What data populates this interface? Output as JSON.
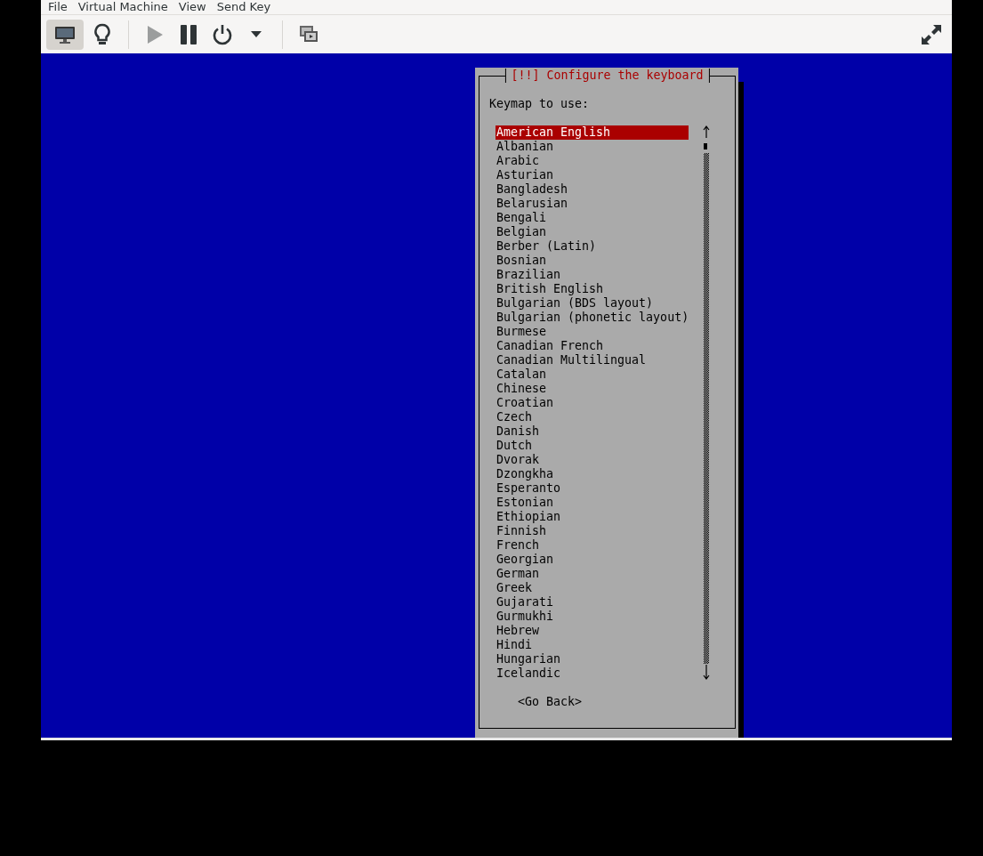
{
  "menu": [
    "File",
    "Virtual Machine",
    "View",
    "Send Key"
  ],
  "toolbar": {
    "groups": [
      [
        {
          "kind": "monitor",
          "selected": true,
          "disabled": false
        },
        {
          "kind": "bulb",
          "selected": false,
          "disabled": false
        }
      ],
      [
        {
          "kind": "play",
          "selected": false,
          "disabled": true
        },
        {
          "kind": "pause",
          "selected": false,
          "disabled": false
        },
        {
          "kind": "power",
          "selected": false,
          "disabled": false
        },
        {
          "kind": "caret",
          "selected": false,
          "disabled": false
        }
      ],
      [
        {
          "kind": "screens",
          "selected": false,
          "disabled": false
        }
      ]
    ],
    "right": [
      {
        "kind": "fullscreen",
        "selected": false,
        "disabled": false
      }
    ]
  },
  "dialog": {
    "title": "[!!] Configure the keyboard",
    "prompt": "Keymap to use:",
    "items": [
      {
        "label": "American English",
        "selected": true
      },
      {
        "label": "Albanian",
        "selected": false
      },
      {
        "label": "Arabic",
        "selected": false
      },
      {
        "label": "Asturian",
        "selected": false
      },
      {
        "label": "Bangladesh",
        "selected": false
      },
      {
        "label": "Belarusian",
        "selected": false
      },
      {
        "label": "Bengali",
        "selected": false
      },
      {
        "label": "Belgian",
        "selected": false
      },
      {
        "label": "Berber (Latin)",
        "selected": false
      },
      {
        "label": "Bosnian",
        "selected": false
      },
      {
        "label": "Brazilian",
        "selected": false
      },
      {
        "label": "British English",
        "selected": false
      },
      {
        "label": "Bulgarian (BDS layout)",
        "selected": false
      },
      {
        "label": "Bulgarian (phonetic layout)",
        "selected": false
      },
      {
        "label": "Burmese",
        "selected": false
      },
      {
        "label": "Canadian French",
        "selected": false
      },
      {
        "label": "Canadian Multilingual",
        "selected": false
      },
      {
        "label": "Catalan",
        "selected": false
      },
      {
        "label": "Chinese",
        "selected": false
      },
      {
        "label": "Croatian",
        "selected": false
      },
      {
        "label": "Czech",
        "selected": false
      },
      {
        "label": "Danish",
        "selected": false
      },
      {
        "label": "Dutch",
        "selected": false
      },
      {
        "label": "Dvorak",
        "selected": false
      },
      {
        "label": "Dzongkha",
        "selected": false
      },
      {
        "label": "Esperanto",
        "selected": false
      },
      {
        "label": "Estonian",
        "selected": false
      },
      {
        "label": "Ethiopian",
        "selected": false
      },
      {
        "label": "Finnish",
        "selected": false
      },
      {
        "label": "French",
        "selected": false
      },
      {
        "label": "Georgian",
        "selected": false
      },
      {
        "label": "German",
        "selected": false
      },
      {
        "label": "Greek",
        "selected": false
      },
      {
        "label": "Gujarati",
        "selected": false
      },
      {
        "label": "Gurmukhi",
        "selected": false
      },
      {
        "label": "Hebrew",
        "selected": false
      },
      {
        "label": "Hindi",
        "selected": false
      },
      {
        "label": "Hungarian",
        "selected": false
      },
      {
        "label": "Icelandic",
        "selected": false
      }
    ],
    "button": "<Go Back>"
  }
}
